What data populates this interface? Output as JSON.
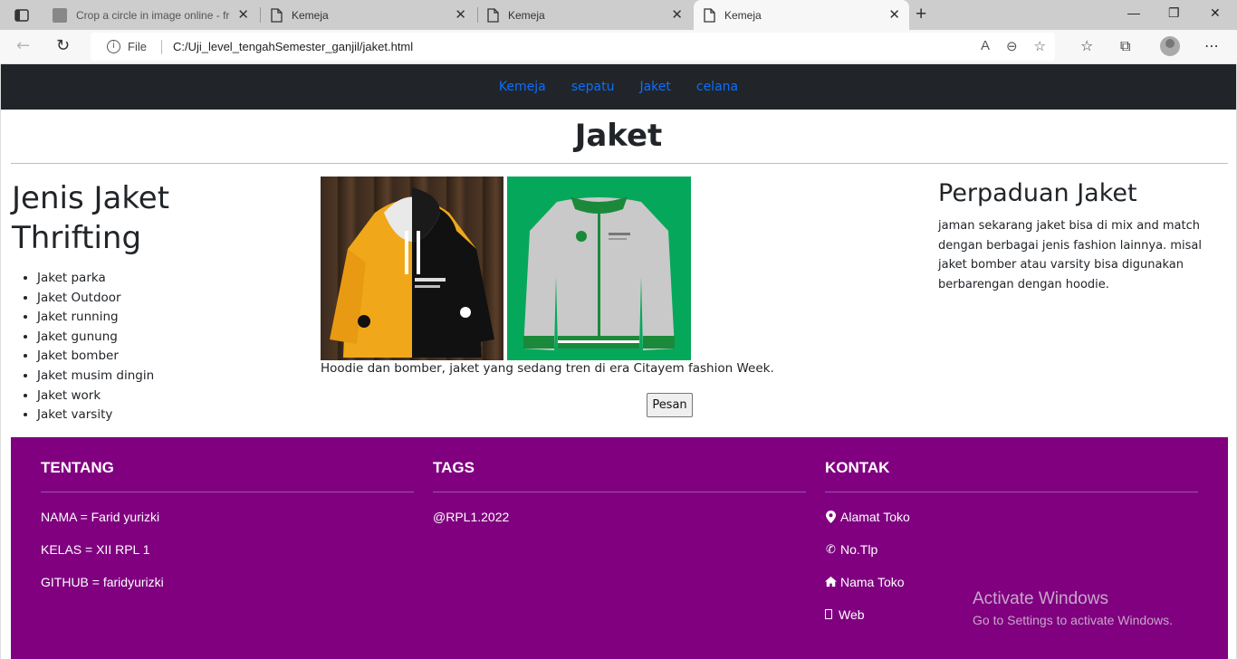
{
  "browser": {
    "tabs": [
      {
        "title": "Crop a circle in image online - fre",
        "active": false
      },
      {
        "title": "Kemeja",
        "active": false
      },
      {
        "title": "Kemeja",
        "active": false
      },
      {
        "title": "Kemeja",
        "active": true
      }
    ],
    "address": {
      "security_label": "File",
      "url": "C:/Uji_level_tengahSemester_ganjil/jaket.html"
    }
  },
  "nav": {
    "items": [
      "Kemeja",
      "sepatu",
      "Jaket",
      "celana"
    ],
    "link_color": "#0d6efd",
    "bg_color": "#212529"
  },
  "page": {
    "title": "Jaket"
  },
  "left": {
    "heading": "Jenis Jaket Thrifting",
    "items": [
      "Jaket parka",
      "Jaket Outdoor",
      "Jaket running",
      "Jaket gunung",
      "Jaket bomber",
      "Jaket musim dingin",
      "Jaket work",
      "Jaket varsity"
    ]
  },
  "middle": {
    "images": [
      {
        "icon": "hoodie-image"
      },
      {
        "icon": "bomber-jacket-image"
      }
    ],
    "caption": "Hoodie dan bomber, jaket yang sedang tren di era Citayem fashion Week.",
    "order_button": "Pesan"
  },
  "right": {
    "heading": "Perpaduan Jaket",
    "text": "jaman sekarang jaket bisa di mix and match dengan berbagai jenis fashion lainnya. misal jaket bomber atau varsity bisa digunakan berbarengan dengan hoodie."
  },
  "footer": {
    "bg_color": "#800080",
    "tentang": {
      "title": "TENTANG",
      "items": [
        "NAMA = Farid yurizki",
        "KELAS = XII RPL 1",
        "GITHUB = faridyurizki"
      ]
    },
    "tags": {
      "title": "TAGS",
      "items": [
        "@RPL1.2022"
      ]
    },
    "kontak": {
      "title": "KONTAK",
      "items": [
        {
          "icon": "map-marker-icon",
          "label": "Alamat Toko"
        },
        {
          "icon": "phone-icon",
          "label": "No.Tlp"
        },
        {
          "icon": "home-icon",
          "label": "Nama Toko"
        },
        {
          "icon": "web-icon",
          "label": "Web"
        }
      ]
    },
    "watermark": {
      "line1": "Activate Windows",
      "line2": "Go to Settings to activate Windows."
    }
  }
}
